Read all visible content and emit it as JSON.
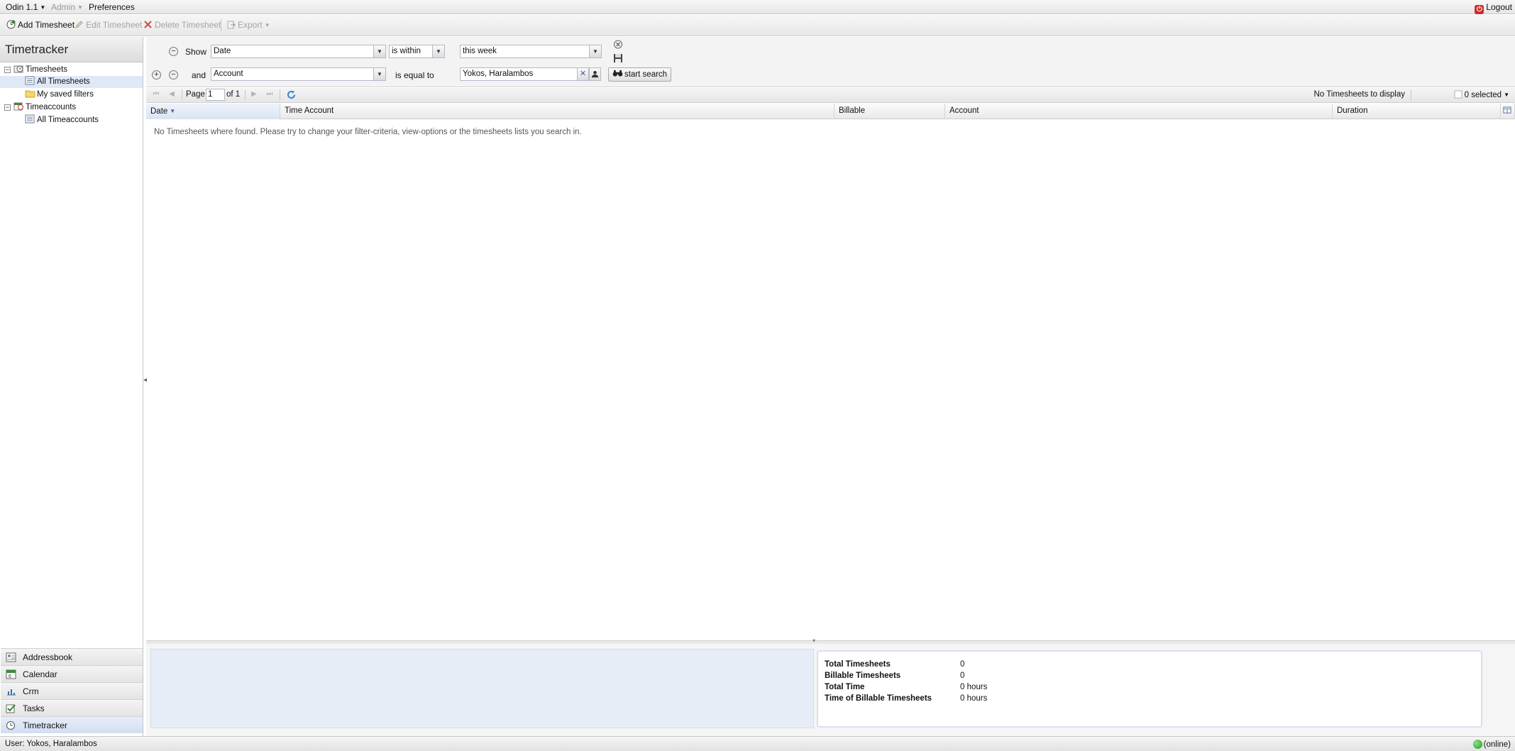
{
  "menubar": {
    "app": "Odin 1.1",
    "admin": "Admin",
    "preferences": "Preferences",
    "logout": "Logout"
  },
  "toolbar": {
    "add": "Add Timesheet",
    "edit": "Edit Timesheet",
    "delete": "Delete Timesheet",
    "export": "Export"
  },
  "leftpanel": {
    "title": "Timetracker",
    "tree": {
      "timesheets": "Timesheets",
      "all_timesheets": "All Timesheets",
      "saved_filters": "My saved filters",
      "timeaccounts": "Timeaccounts",
      "all_timeaccounts": "All Timeaccounts"
    },
    "apps": [
      "Addressbook",
      "Calendar",
      "Crm",
      "Tasks",
      "Timetracker"
    ]
  },
  "filter": {
    "row1": {
      "prefix": "Show",
      "field": "Date",
      "operator": "is within",
      "value": "this week"
    },
    "row2": {
      "prefix": "and",
      "field": "Account",
      "operator": "is equal to",
      "value": "Yokos, Haralambos"
    },
    "search_button": "start search"
  },
  "paging": {
    "page_label": "Page",
    "page": "1",
    "of_label": "of 1",
    "display_msg": "No Timesheets to display",
    "selected": "0 selected"
  },
  "grid": {
    "columns": [
      "Date",
      "Time Account",
      "Billable",
      "Account",
      "Duration"
    ],
    "empty_message": "No Timesheets where found. Please try to change your filter-criteria, view-options or the timesheets lists you search in."
  },
  "summary": {
    "rows": [
      {
        "label": "Total Timesheets",
        "value": "0"
      },
      {
        "label": "Billable Timesheets",
        "value": "0"
      },
      {
        "label": "Total Time",
        "value": "0 hours"
      },
      {
        "label": "Time of Billable Timesheets",
        "value": "0 hours"
      }
    ]
  },
  "statusbar": {
    "user": "User: Yokos, Haralambos",
    "online": "(online)"
  },
  "colors": {
    "selection": "#dfe8f6",
    "logout_red": "#cc2a2a",
    "online_green": "#1f9b1a"
  }
}
